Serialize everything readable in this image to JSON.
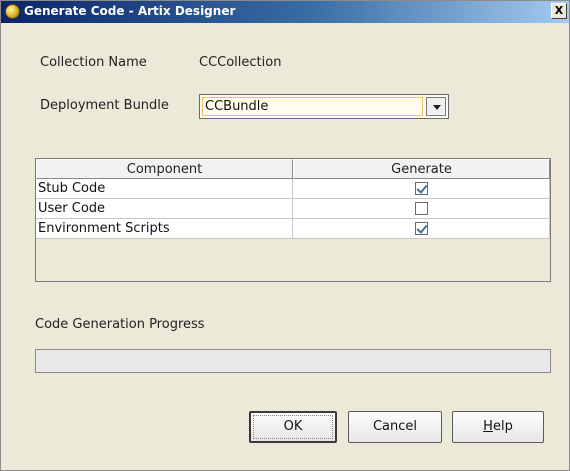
{
  "window": {
    "title": "Generate Code - Artix Designer",
    "close_glyph": "X"
  },
  "form": {
    "collection_label": "Collection Name",
    "collection_value": "CCCollection",
    "bundle_label": "Deployment Bundle",
    "bundle_value": "CCBundle"
  },
  "table": {
    "columns": [
      "Component",
      "Generate"
    ],
    "rows": [
      {
        "component": "Stub Code",
        "generate": true
      },
      {
        "component": "User Code",
        "generate": false
      },
      {
        "component": "Environment Scripts",
        "generate": true
      }
    ]
  },
  "progress": {
    "label": "Code Generation Progress",
    "value": 0
  },
  "buttons": {
    "ok": "OK",
    "cancel": "Cancel",
    "help_mnemonic": "H",
    "help_rest": "elp"
  },
  "colors": {
    "titlebar_start": "#0a246a",
    "titlebar_end": "#a6caf0",
    "dialog_bg": "#ece9d8"
  },
  "icons": {
    "app": "artix-app-icon",
    "close": "close-icon",
    "dropdown": "chevron-down-icon",
    "check": "checkmark-icon"
  }
}
